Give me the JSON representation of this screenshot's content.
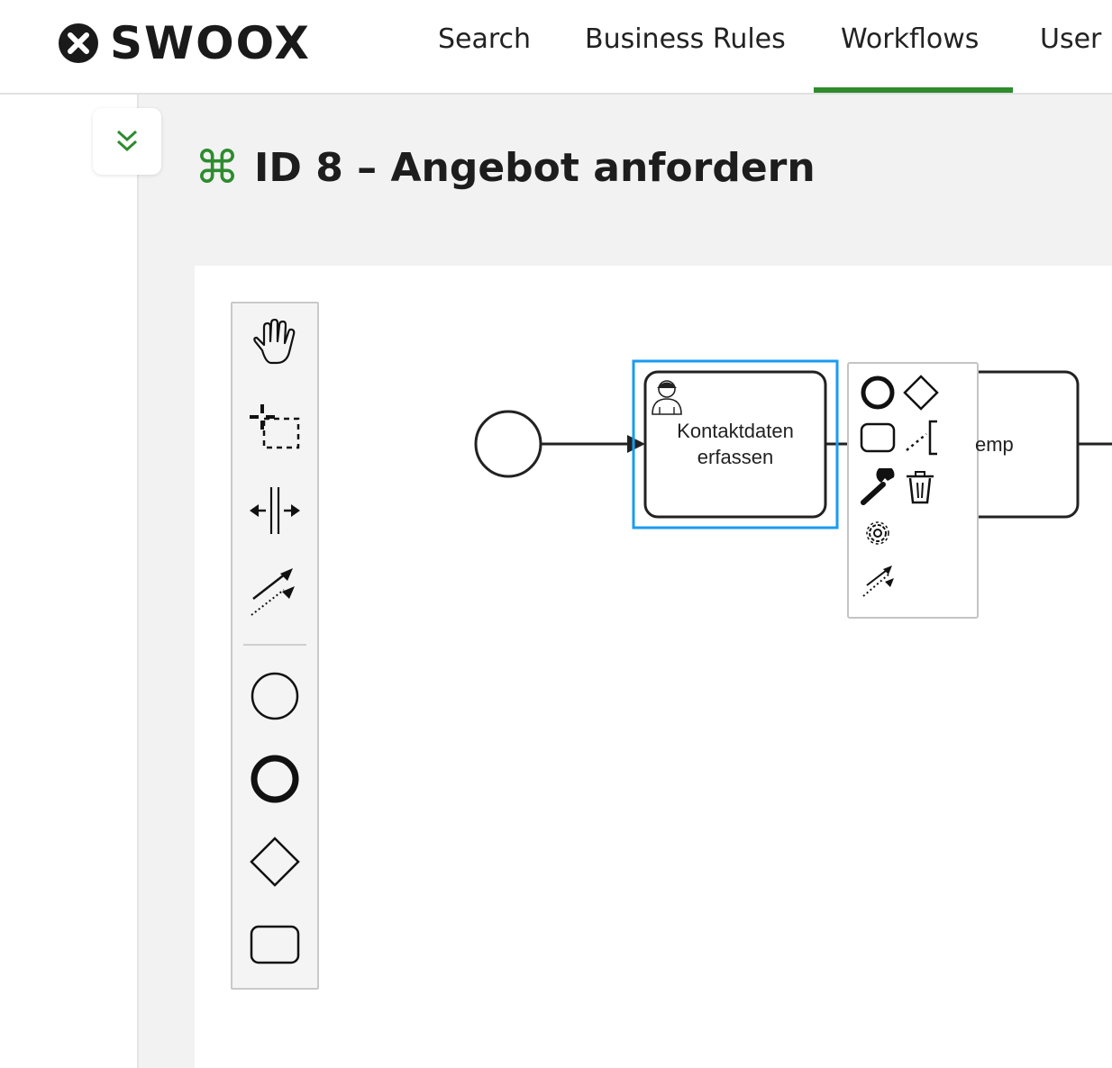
{
  "brand": {
    "name": "SWOOX",
    "accent_color": "#2e8b2e"
  },
  "nav": {
    "items": [
      {
        "label": "Search"
      },
      {
        "label": "Business Rules"
      },
      {
        "label": "Workflows",
        "active": true
      },
      {
        "label": "User"
      }
    ]
  },
  "sidebar": {
    "toggle_icon": "double-chevron-down-icon"
  },
  "page": {
    "title_icon": "⌘",
    "title": "ID 8 – Angebot anfordern"
  },
  "palette": {
    "tools": [
      {
        "name": "hand-tool",
        "icon": "hand-icon"
      },
      {
        "name": "lasso-tool",
        "icon": "lasso-icon"
      },
      {
        "name": "space-tool",
        "icon": "space-icon"
      },
      {
        "name": "global-connect-tool",
        "icon": "connect-icon"
      },
      {
        "name": "create-start-event",
        "icon": "start-event-icon"
      },
      {
        "name": "create-end-event",
        "icon": "end-event-icon"
      },
      {
        "name": "create-gateway",
        "icon": "gateway-icon"
      },
      {
        "name": "create-task",
        "icon": "task-icon"
      }
    ]
  },
  "diagram": {
    "selected_task": {
      "label_line1": "Kontaktdaten",
      "label_line2": "erfassen",
      "type_icon": "user-icon"
    },
    "next_task": {
      "label_partial": "emp"
    },
    "selection_color": "#1a9bf0"
  },
  "context_pad": {
    "entries": [
      {
        "name": "append-end-event",
        "icon": "end-event-icon"
      },
      {
        "name": "append-gateway",
        "icon": "gateway-icon"
      },
      {
        "name": "append-task",
        "icon": "task-icon"
      },
      {
        "name": "append-text-annotation",
        "icon": "text-annotation-icon"
      },
      {
        "name": "change-type",
        "icon": "wrench-icon"
      },
      {
        "name": "delete",
        "icon": "trash-icon"
      },
      {
        "name": "properties",
        "icon": "gear-icon"
      },
      {
        "name": "connect",
        "icon": "connect-icon"
      }
    ]
  }
}
